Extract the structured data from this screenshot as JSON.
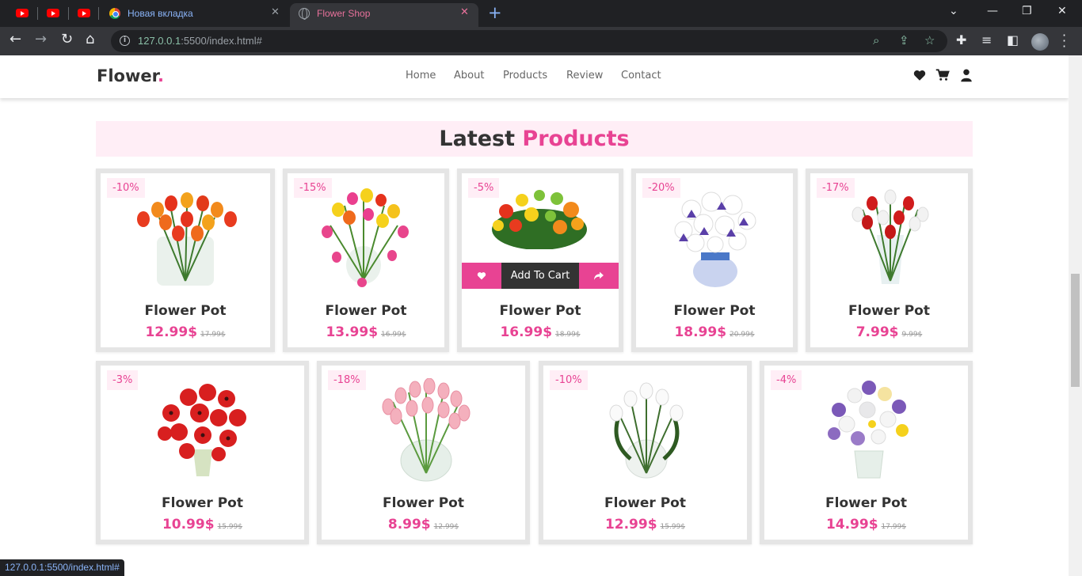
{
  "browser": {
    "tabs": [
      {
        "title": "Новая вкладка",
        "active": false
      },
      {
        "title": "Flower Shop",
        "active": true
      }
    ],
    "url_host": "127.0.0.1",
    "url_path": ":5500/index.html#",
    "status_url": "127.0.0.1:5500/index.html#"
  },
  "site": {
    "logo": "Flower",
    "logo_dot": ".",
    "nav": [
      "Home",
      "About",
      "Products",
      "Review",
      "Contact"
    ],
    "icons": [
      "heart-icon",
      "cart-icon",
      "user-icon"
    ]
  },
  "section": {
    "title": "Latest",
    "title_accent": "Products"
  },
  "cart_bar": {
    "add_label": "Add To Cart"
  },
  "products": [
    {
      "discount": "-10%",
      "name": "Flower Pot",
      "price": "12.99$",
      "old_price": "17.99$"
    },
    {
      "discount": "-15%",
      "name": "Flower Pot",
      "price": "13.99$",
      "old_price": "16.99$"
    },
    {
      "discount": "-5%",
      "name": "Flower Pot",
      "price": "16.99$",
      "old_price": "18.99$"
    },
    {
      "discount": "-20%",
      "name": "Flower Pot",
      "price": "18.99$",
      "old_price": "20.99$"
    },
    {
      "discount": "-17%",
      "name": "Flower Pot",
      "price": "7.99$",
      "old_price": "9.99$"
    },
    {
      "discount": "-3%",
      "name": "Flower Pot",
      "price": "10.99$",
      "old_price": "15.99$"
    },
    {
      "discount": "-18%",
      "name": "Flower Pot",
      "price": "8.99$",
      "old_price": "12.99$"
    },
    {
      "discount": "-10%",
      "name": "Flower Pot",
      "price": "12.99$",
      "old_price": "15.99$"
    },
    {
      "discount": "-4%",
      "name": "Flower Pot",
      "price": "14.99$",
      "old_price": "17.99$"
    }
  ],
  "colors": {
    "accent": "#e84393",
    "title_bg": "#ffeef6",
    "text": "#333333"
  }
}
